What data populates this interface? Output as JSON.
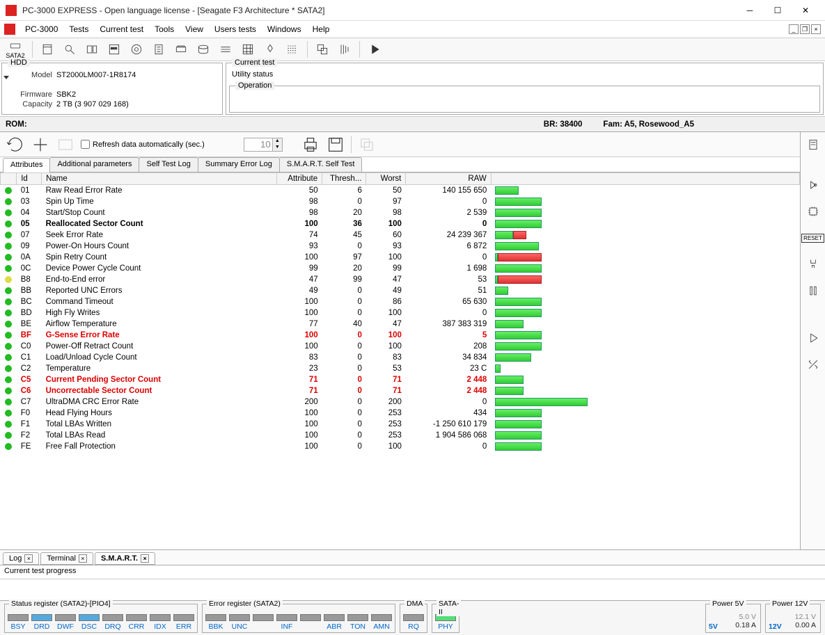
{
  "window": {
    "title": "PC-3000 EXPRESS - Open language license - [Seagate F3 Architecture * SATA2]"
  },
  "menu": [
    "PC-3000",
    "Tests",
    "Current test",
    "Tools",
    "View",
    "Users tests",
    "Windows",
    "Help"
  ],
  "toolbar_port": "SATA2",
  "hdd": {
    "legend": "HDD",
    "model_lbl": "Model",
    "model": "ST2000LM007-1R8174",
    "firmware_lbl": "Firmware",
    "firmware": "SBK2",
    "capacity_lbl": "Capacity",
    "capacity": "2 TB (3 907 029 168)"
  },
  "current_test": {
    "legend": "Current test",
    "caption": "Utility status",
    "operation_legend": "Operation"
  },
  "rom": {
    "label": "ROM:",
    "br": "BR: 38400",
    "fam": "Fam: A5, Rosewood_A5"
  },
  "actionbar": {
    "refresh_label": "Refresh data automatically (sec.)",
    "refresh_value": "10"
  },
  "subtabs": [
    "Attributes",
    "Additional parameters",
    "Self Test Log",
    "Summary Error Log",
    "S.M.A.R.T. Self Test"
  ],
  "smart_headers": [
    "",
    "Id",
    "Name",
    "Attribute",
    "Thresh...",
    "Worst",
    "RAW",
    ""
  ],
  "smart_rows": [
    {
      "dot": "g",
      "id": "01",
      "name": "Raw Read Error Rate",
      "attr": 50,
      "thr": 6,
      "worst": 50,
      "raw": "140 155 650",
      "g0": 0,
      "g1": 9,
      "r0": 0,
      "r1": 0
    },
    {
      "dot": "g",
      "id": "03",
      "name": "Spin Up Time",
      "attr": 98,
      "thr": 0,
      "worst": 97,
      "raw": "0",
      "g0": 0,
      "g1": 18,
      "r0": 0,
      "r1": 0
    },
    {
      "dot": "g",
      "id": "04",
      "name": "Start/Stop Count",
      "attr": 98,
      "thr": 20,
      "worst": 98,
      "raw": "2 539",
      "g0": 0,
      "g1": 18,
      "r0": 0,
      "r1": 0
    },
    {
      "dot": "g",
      "id": "05",
      "name": "Reallocated Sector Count",
      "attr": 100,
      "thr": 36,
      "worst": 100,
      "raw": "0",
      "g0": 0,
      "g1": 18,
      "r0": 0,
      "r1": 0,
      "bold": true
    },
    {
      "dot": "g",
      "id": "07",
      "name": "Seek Error Rate",
      "attr": 74,
      "thr": 45,
      "worst": 60,
      "raw": "24 239 367",
      "g0": 0,
      "g1": 7,
      "r0": 7,
      "r1": 5
    },
    {
      "dot": "g",
      "id": "09",
      "name": "Power-On Hours Count",
      "attr": 93,
      "thr": 0,
      "worst": 93,
      "raw": "6 872",
      "g0": 0,
      "g1": 17,
      "r0": 0,
      "r1": 0
    },
    {
      "dot": "g",
      "id": "0A",
      "name": "Spin Retry Count",
      "attr": 100,
      "thr": 97,
      "worst": 100,
      "raw": "0",
      "g0": 0,
      "g1": 1,
      "r0": 1,
      "r1": 17
    },
    {
      "dot": "g",
      "id": "0C",
      "name": "Device Power Cycle Count",
      "attr": 99,
      "thr": 20,
      "worst": 99,
      "raw": "1 698",
      "g0": 0,
      "g1": 18,
      "r0": 0,
      "r1": 0
    },
    {
      "dot": "y",
      "id": "B8",
      "name": "End-to-End error",
      "attr": 47,
      "thr": 99,
      "worst": 47,
      "raw": "53",
      "g0": 0,
      "g1": 1,
      "r0": 1,
      "r1": 17
    },
    {
      "dot": "g",
      "id": "BB",
      "name": "Reported UNC Errors",
      "attr": 49,
      "thr": 0,
      "worst": 49,
      "raw": "51",
      "g0": 0,
      "g1": 5,
      "r0": 0,
      "r1": 0
    },
    {
      "dot": "g",
      "id": "BC",
      "name": "Command Timeout",
      "attr": 100,
      "thr": 0,
      "worst": 86,
      "raw": "65 630",
      "g0": 0,
      "g1": 18,
      "r0": 0,
      "r1": 0
    },
    {
      "dot": "g",
      "id": "BD",
      "name": "High Fly Writes",
      "attr": 100,
      "thr": 0,
      "worst": 100,
      "raw": "0",
      "g0": 0,
      "g1": 18,
      "r0": 0,
      "r1": 0
    },
    {
      "dot": "g",
      "id": "BE",
      "name": "Airflow Temperature",
      "attr": 77,
      "thr": 40,
      "worst": 47,
      "raw": "387 383 319",
      "g0": 0,
      "g1": 11,
      "r0": 0,
      "r1": 0
    },
    {
      "dot": "g",
      "id": "BF",
      "name": "G-Sense Error Rate",
      "attr": 100,
      "thr": 0,
      "worst": 100,
      "raw": "5",
      "g0": 0,
      "g1": 18,
      "r0": 0,
      "r1": 0,
      "red": true
    },
    {
      "dot": "g",
      "id": "C0",
      "name": "Power-Off Retract Count",
      "attr": 100,
      "thr": 0,
      "worst": 100,
      "raw": "208",
      "g0": 0,
      "g1": 18,
      "r0": 0,
      "r1": 0
    },
    {
      "dot": "g",
      "id": "C1",
      "name": "Load/Unload Cycle Count",
      "attr": 83,
      "thr": 0,
      "worst": 83,
      "raw": "34 834",
      "g0": 0,
      "g1": 14,
      "r0": 0,
      "r1": 0
    },
    {
      "dot": "g",
      "id": "C2",
      "name": "Temperature",
      "attr": 23,
      "thr": 0,
      "worst": 53,
      "raw": "23 C",
      "g0": 0,
      "g1": 2,
      "r0": 0,
      "r1": 0
    },
    {
      "dot": "g",
      "id": "C5",
      "name": "Current Pending Sector Count",
      "attr": 71,
      "thr": 0,
      "worst": 71,
      "raw": "2 448",
      "g0": 0,
      "g1": 11,
      "r0": 0,
      "r1": 0,
      "red": true
    },
    {
      "dot": "g",
      "id": "C6",
      "name": "Uncorrectable Sector Count",
      "attr": 71,
      "thr": 0,
      "worst": 71,
      "raw": "2 448",
      "g0": 0,
      "g1": 11,
      "r0": 0,
      "r1": 0,
      "red": true
    },
    {
      "dot": "g",
      "id": "C7",
      "name": "UltraDMA CRC Error Rate",
      "attr": 200,
      "thr": 0,
      "worst": 200,
      "raw": "0",
      "g0": 0,
      "g1": 36,
      "r0": 0,
      "r1": 0
    },
    {
      "dot": "g",
      "id": "F0",
      "name": "Head Flying Hours",
      "attr": 100,
      "thr": 0,
      "worst": 253,
      "raw": "434",
      "g0": 0,
      "g1": 18,
      "r0": 0,
      "r1": 0
    },
    {
      "dot": "g",
      "id": "F1",
      "name": "Total LBAs Written",
      "attr": 100,
      "thr": 0,
      "worst": 253,
      "raw": "-1 250 610 179",
      "g0": 0,
      "g1": 18,
      "r0": 0,
      "r1": 0
    },
    {
      "dot": "g",
      "id": "F2",
      "name": "Total LBAs Read",
      "attr": 100,
      "thr": 0,
      "worst": 253,
      "raw": "1 904 586 068",
      "g0": 0,
      "g1": 18,
      "r0": 0,
      "r1": 0
    },
    {
      "dot": "g",
      "id": "FE",
      "name": "Free Fall Protection",
      "attr": 100,
      "thr": 0,
      "worst": 100,
      "raw": "0",
      "g0": 0,
      "g1": 18,
      "r0": 0,
      "r1": 0
    }
  ],
  "bottom_tabs": [
    {
      "label": "Log",
      "close": true,
      "active": false
    },
    {
      "label": "Terminal",
      "close": true,
      "active": false
    },
    {
      "label": "S.M.A.R.T.",
      "close": true,
      "active": true
    }
  ],
  "progress_label": "Current test progress",
  "status_register": {
    "label": "Status register (SATA2)-[PIO4]",
    "leds": [
      {
        "n": "BSY",
        "on": false
      },
      {
        "n": "DRD",
        "on": true
      },
      {
        "n": "DWF",
        "on": false
      },
      {
        "n": "DSC",
        "on": true
      },
      {
        "n": "DRQ",
        "on": false
      },
      {
        "n": "CRR",
        "on": false
      },
      {
        "n": "IDX",
        "on": false
      },
      {
        "n": "ERR",
        "on": false
      }
    ]
  },
  "error_register": {
    "label": "Error register (SATA2)",
    "leds": [
      {
        "n": "BBK",
        "on": false
      },
      {
        "n": "UNC",
        "on": false
      },
      {
        "n": "",
        "on": false
      },
      {
        "n": "INF",
        "on": false
      },
      {
        "n": "",
        "on": false
      },
      {
        "n": "ABR",
        "on": false
      },
      {
        "n": "TON",
        "on": false
      },
      {
        "n": "AMN",
        "on": false
      }
    ]
  },
  "dma": {
    "label": "DMA",
    "leds": [
      {
        "n": "RQ",
        "on": false
      }
    ]
  },
  "sata2": {
    "label": "SATA-II",
    "leds": [
      {
        "n": "PHY",
        "on": "green"
      }
    ]
  },
  "power5": {
    "label": "Power 5V",
    "v": "5.0 V",
    "a": "0.18 A",
    "lbl": "5V"
  },
  "power12": {
    "label": "Power 12V",
    "v": "12.1 V",
    "a": "0.00 A",
    "lbl": "12V"
  }
}
